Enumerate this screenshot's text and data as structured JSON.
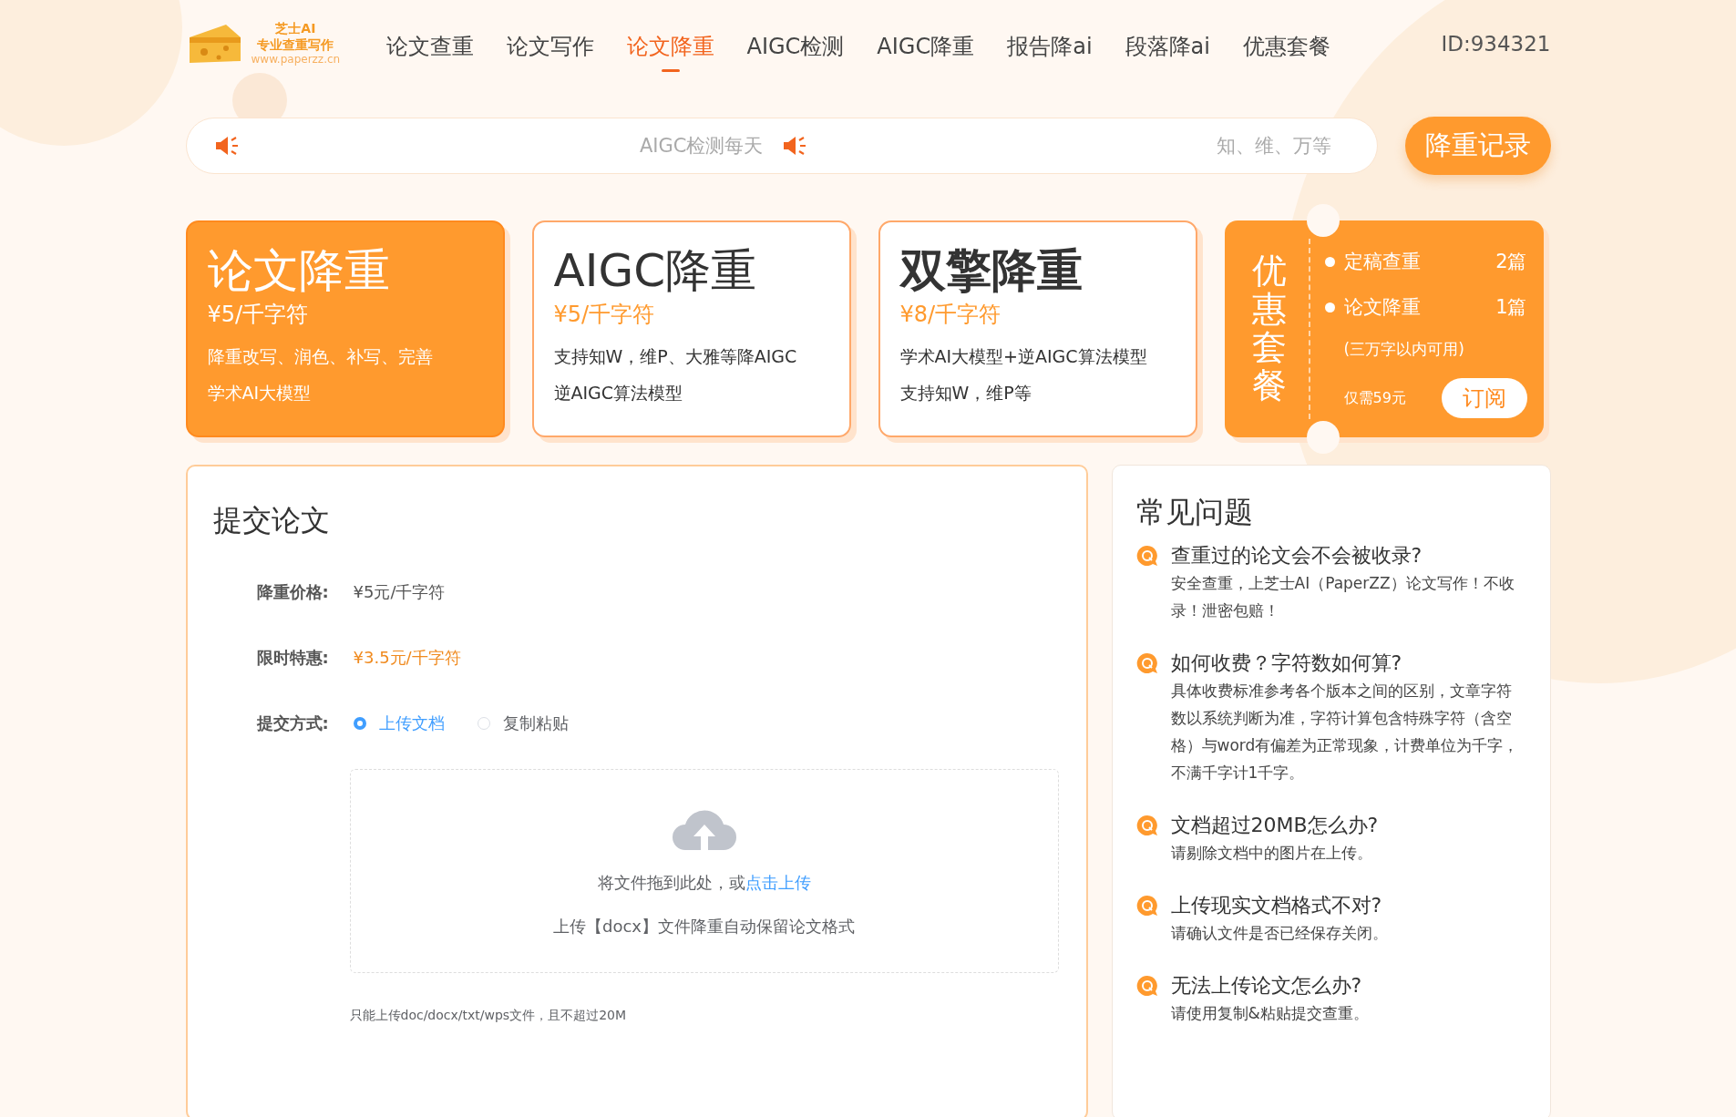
{
  "logo": {
    "title": "芝士AI",
    "subtitle": "专业查重写作",
    "url": "www.paperzz.cn"
  },
  "nav": [
    {
      "label": "论文查重",
      "selected": false
    },
    {
      "label": "论文写作",
      "selected": false
    },
    {
      "label": "论文降重",
      "selected": true
    },
    {
      "label": "AIGC检测",
      "selected": false
    },
    {
      "label": "AIGC降重",
      "selected": false
    },
    {
      "label": "报告降ai",
      "selected": false
    },
    {
      "label": "段落降ai",
      "selected": false
    },
    {
      "label": "优惠套餐",
      "selected": false
    }
  ],
  "user_id": "ID:934321",
  "notices": [
    "AIGC检测每天",
    "知、维、万等"
  ],
  "record_button": "降重记录",
  "services": [
    {
      "title": "论文降重",
      "price": "¥5/千字符",
      "lines": [
        "降重改写、润色、补写、完善",
        "学术AI大模型"
      ],
      "selected": true,
      "bold": false
    },
    {
      "title": "AIGC降重",
      "price": "¥5/千字符",
      "lines": [
        "支持知W，维P、大雅等降AIGC",
        "逆AIGC算法模型"
      ],
      "selected": false,
      "bold": false
    },
    {
      "title": "双擎降重",
      "price": "¥8/千字符",
      "lines": [
        "学术AI大模型+逆AIGC算法模型",
        "支持知W，维P等"
      ],
      "selected": false,
      "bold": true
    }
  ],
  "package": {
    "title": "优惠套餐",
    "items": [
      {
        "name": "定稿查重",
        "count": "2篇"
      },
      {
        "name": "论文降重",
        "count": "1篇"
      }
    ],
    "note": "(三万字以内可用)",
    "price": "仅需59元",
    "button": "订阅"
  },
  "submit": {
    "title": "提交论文",
    "fields": [
      {
        "label": "降重价格:",
        "value": "¥5元/千字符",
        "kind": "plain"
      },
      {
        "label": "限时特惠:",
        "value": "¥3.5元/千字符",
        "kind": "highlight"
      }
    ],
    "method_label": "提交方式:",
    "methods": [
      {
        "label": "上传文档",
        "selected": true
      },
      {
        "label": "复制粘贴",
        "selected": false
      }
    ],
    "drop_text": "将文件拖到此处，或",
    "drop_link": "点击上传",
    "drop_hint": "上传【docx】文件降重自动保留论文格式",
    "limit": "只能上传doc/docx/txt/wps文件，且不超过20M"
  },
  "faq": {
    "title": "常见问题",
    "items": [
      {
        "q": "查重过的论文会不会被收录?",
        "a": "安全查重，上芝士AI（PaperZZ）论文写作！不收录！泄密包赔！"
      },
      {
        "q": "如何收费？字符数如何算?",
        "a": "具体收费标准参考各个版本之间的区别，文章字符数以系统判断为准，字符计算包含特殊字符（含空格）与word有偏差为正常现象，计费单位为千字，不满千字计1千字。"
      },
      {
        "q": "文档超过20MB怎么办?",
        "a": "请剔除文档中的图片在上传。"
      },
      {
        "q": "上传现实文档格式不对?",
        "a": "请确认文件是否已经保存关闭。"
      },
      {
        "q": "无法上传论文怎么办?",
        "a": "请使用复制&粘贴提交查重。"
      }
    ]
  }
}
